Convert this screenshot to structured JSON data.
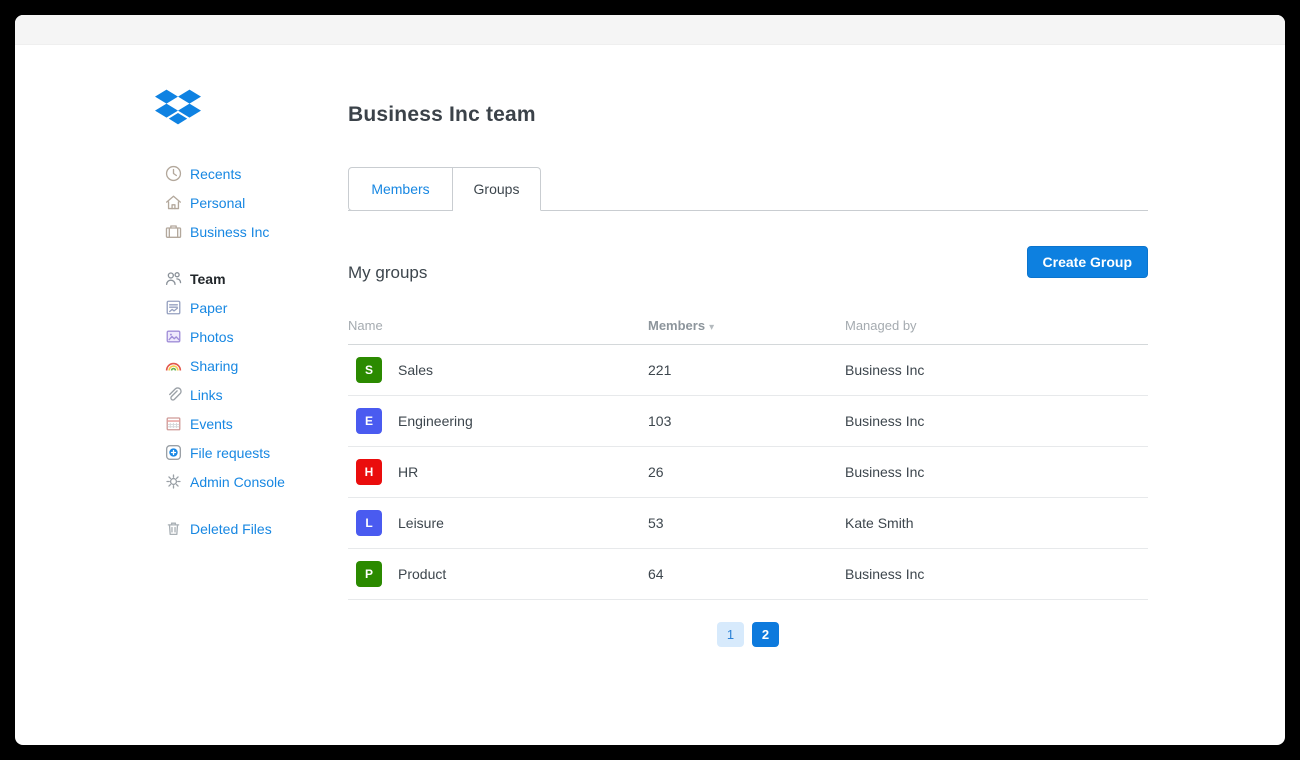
{
  "colors": {
    "accent_blue": "#1787e2",
    "button_blue": "#0d80e0",
    "logo_blue": "#0f82e2",
    "group_green": "#2b8a00",
    "group_indigo": "#4a5bf0",
    "group_red": "#ea0d0d"
  },
  "header": {
    "title": "Business Inc team"
  },
  "tabs": [
    {
      "label": "Members",
      "active": false
    },
    {
      "label": "Groups",
      "active": true
    }
  ],
  "sidebar": {
    "groups": {
      "g0": {
        "items": [
          {
            "label": "Recents",
            "icon": "clock"
          },
          {
            "label": "Personal",
            "icon": "home"
          },
          {
            "label": "Business Inc",
            "icon": "briefcase"
          }
        ]
      },
      "g1": {
        "items": [
          {
            "label": "Team",
            "icon": "team",
            "active": true
          },
          {
            "label": "Paper",
            "icon": "paper"
          },
          {
            "label": "Photos",
            "icon": "photos"
          },
          {
            "label": "Sharing",
            "icon": "rainbow"
          },
          {
            "label": "Links",
            "icon": "paperclip"
          },
          {
            "label": "Events",
            "icon": "calendar"
          },
          {
            "label": "File requests",
            "icon": "file-request"
          },
          {
            "label": "Admin Console",
            "icon": "gear"
          }
        ]
      },
      "g2": {
        "items": [
          {
            "label": "Deleted Files",
            "icon": "trash"
          }
        ]
      }
    }
  },
  "main": {
    "section_title": "My groups",
    "create_button_label": "Create Group",
    "table": {
      "columns": [
        "Name",
        "Members",
        "Managed by"
      ],
      "sorted_column": "Members",
      "sort_indicator": "▾",
      "rows": [
        {
          "initial": "S",
          "color": "#2b8a00",
          "name": "Sales",
          "members": "221",
          "managed_by": "Business Inc"
        },
        {
          "initial": "E",
          "color": "#4a5bf0",
          "name": "Engineering",
          "members": "103",
          "managed_by": "Business Inc"
        },
        {
          "initial": "H",
          "color": "#ea0d0d",
          "name": "HR",
          "members": "26",
          "managed_by": "Business Inc"
        },
        {
          "initial": "L",
          "color": "#4a5bf0",
          "name": "Leisure",
          "members": "53",
          "managed_by": "Kate Smith"
        },
        {
          "initial": "P",
          "color": "#2b8a00",
          "name": "Product",
          "members": "64",
          "managed_by": "Business Inc"
        }
      ]
    },
    "pagination": [
      {
        "label": "1",
        "active": false
      },
      {
        "label": "2",
        "active": true
      }
    ]
  }
}
